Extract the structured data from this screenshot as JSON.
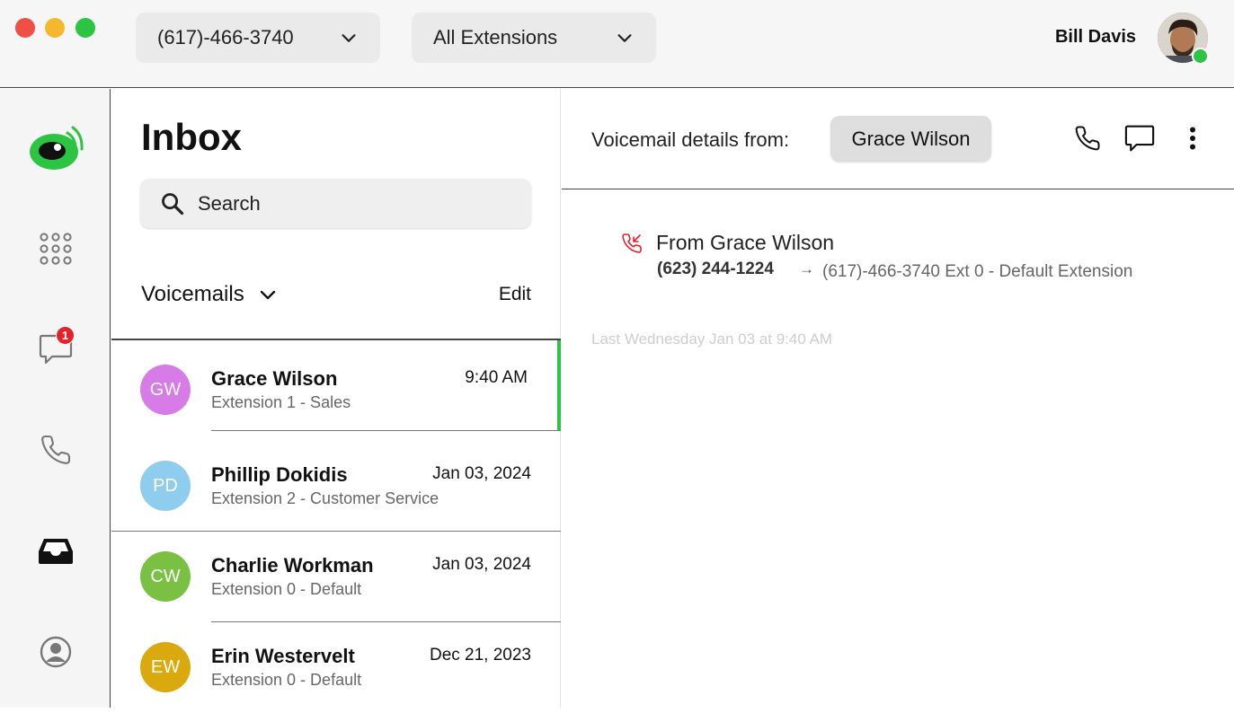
{
  "titlebar": {
    "phone_number": "(617)-466-3740",
    "extension_filter": "All Extensions",
    "user_name": "Bill Davis"
  },
  "rail": {
    "messages_badge": "1"
  },
  "inbox": {
    "title": "Inbox",
    "search_placeholder": "Search",
    "section_title": "Voicemails",
    "edit_label": "Edit",
    "items": [
      {
        "initials": "GW",
        "name": "Grace Wilson",
        "subtitle": "Extension 1 - Sales",
        "time": "9:40 AM",
        "color": "#d77be6"
      },
      {
        "initials": "PD",
        "name": "Phillip Dokidis",
        "subtitle": "Extension 2 - Customer Service",
        "time": "Jan 03, 2024",
        "color": "#8fcdef"
      },
      {
        "initials": "CW",
        "name": "Charlie Workman",
        "subtitle": "Extension 0 - Default",
        "time": "Jan 03, 2024",
        "color": "#7ac143"
      },
      {
        "initials": "EW",
        "name": "Erin Westervelt",
        "subtitle": "Extension 0 - Default",
        "time": "Dec 21, 2023",
        "color": "#d9a90d"
      }
    ]
  },
  "detail": {
    "label": "Voicemail details from:",
    "contact": "Grace Wilson",
    "from_title": "From Grace Wilson",
    "from_number": "(623) 244-1224",
    "arrow": "→",
    "destination": "(617)-466-3740 Ext 0 - Default Extension",
    "timestamp": "Last Wednesday Jan 03 at 9:40 AM"
  },
  "colors": {
    "accent_green": "#2cc442",
    "badge_red": "#e3232c",
    "missed_call_red": "#e3232c"
  }
}
